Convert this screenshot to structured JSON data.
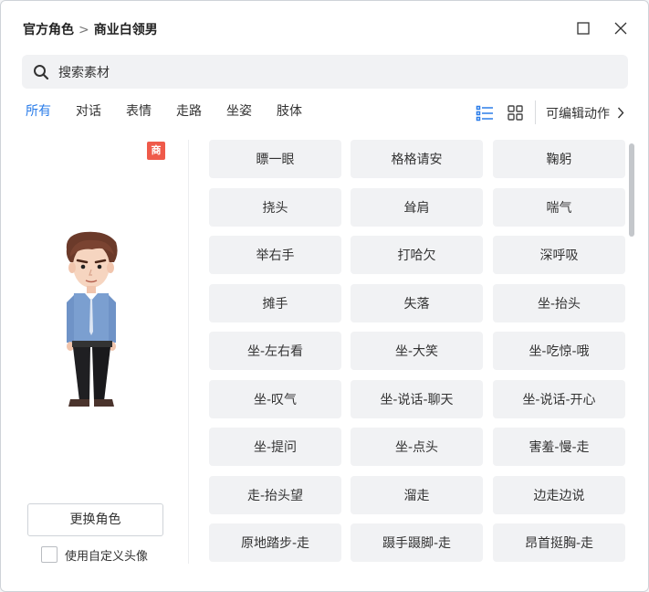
{
  "breadcrumb": {
    "parent": "官方角色",
    "separator": ">",
    "current": "商业白领男"
  },
  "search": {
    "placeholder": "搜索素材",
    "value": ""
  },
  "tabs": [
    {
      "label": "所有",
      "active": true
    },
    {
      "label": "对话",
      "active": false
    },
    {
      "label": "表情",
      "active": false
    },
    {
      "label": "走路",
      "active": false
    },
    {
      "label": "坐姿",
      "active": false
    },
    {
      "label": "肢体",
      "active": false
    }
  ],
  "toolbar": {
    "editable_label": "可编辑动作"
  },
  "character": {
    "badge": "商",
    "change_button": "更换角色",
    "custom_avatar_label": "使用自定义头像",
    "custom_avatar_checked": false
  },
  "actions": [
    "瞟一眼",
    "格格请安",
    "鞠躬",
    "挠头",
    "耸肩",
    "喘气",
    "举右手",
    "打哈欠",
    "深呼吸",
    "摊手",
    "失落",
    "坐-抬头",
    "坐-左右看",
    "坐-大笑",
    "坐-吃惊-哦",
    "坐-叹气",
    "坐-说话-聊天",
    "坐-说话-开心",
    "坐-提问",
    "坐-点头",
    "害羞-慢-走",
    "走-抬头望",
    "溜走",
    "边走边说",
    "原地踏步-走",
    "蹑手蹑脚-走",
    "昂首挺胸-走"
  ],
  "colors": {
    "accent": "#2b7de9",
    "badge": "#ef5a4a",
    "button_bg": "#f1f2f4"
  },
  "icons": {
    "search": "search-icon",
    "list_view": "list-view-icon",
    "grid_view": "grid-view-icon",
    "close": "close-icon",
    "maximize": "maximize-icon",
    "chevron": "chevron-right-icon"
  }
}
